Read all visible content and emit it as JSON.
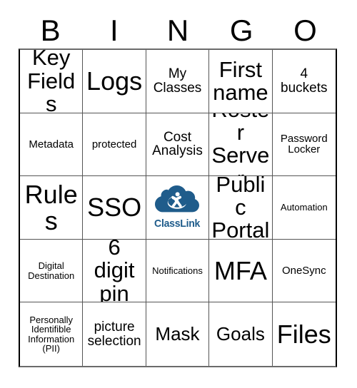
{
  "header": {
    "letters": [
      "B",
      "I",
      "N",
      "G",
      "O"
    ]
  },
  "grid": {
    "rows": 5,
    "columns": 5,
    "cells": [
      {
        "text": "Key\nFields",
        "size": "fs-xl",
        "type": "text"
      },
      {
        "text": "Logs",
        "size": "fs-xxl",
        "type": "text"
      },
      {
        "text": "My\nClasses",
        "size": "fs-md",
        "type": "text"
      },
      {
        "text": "First\nname",
        "size": "fs-xl",
        "type": "text"
      },
      {
        "text": "4\nbuckets",
        "size": "fs-md",
        "type": "text"
      },
      {
        "text": "Metadata",
        "size": "fs-sm",
        "type": "text"
      },
      {
        "text": "protected",
        "size": "fs-sm",
        "type": "text"
      },
      {
        "text": "Cost\nAnalysis",
        "size": "fs-md",
        "type": "text"
      },
      {
        "text": "Roster\nServer",
        "size": "fs-xl",
        "type": "text"
      },
      {
        "text": "Password\nLocker",
        "size": "fs-sm",
        "type": "text"
      },
      {
        "text": "Rules",
        "size": "fs-xxl",
        "type": "text"
      },
      {
        "text": "SSO",
        "size": "fs-xxl",
        "type": "text"
      },
      {
        "text": "ClassLink",
        "size": "fs-sm",
        "type": "logo"
      },
      {
        "text": "Public\nPortal",
        "size": "fs-xl",
        "type": "text"
      },
      {
        "text": "Automation",
        "size": "fs-xs",
        "type": "text"
      },
      {
        "text": "Digital\nDestination",
        "size": "fs-xs",
        "type": "text"
      },
      {
        "text": "6 digit\npin",
        "size": "fs-xl",
        "type": "text"
      },
      {
        "text": "Notifications",
        "size": "fs-xs",
        "type": "text"
      },
      {
        "text": "MFA",
        "size": "fs-xxl",
        "type": "text"
      },
      {
        "text": "OneSync",
        "size": "fs-sm",
        "type": "text"
      },
      {
        "text": "Personally\nIdentifible\nInformation\n(PII)",
        "size": "fs-xs",
        "type": "text"
      },
      {
        "text": "picture\nselection",
        "size": "fs-md",
        "type": "text"
      },
      {
        "text": "Mask",
        "size": "fs-lg",
        "type": "text"
      },
      {
        "text": "Goals",
        "size": "fs-lg",
        "type": "text"
      },
      {
        "text": "Files",
        "size": "fs-xxl",
        "type": "text"
      }
    ]
  },
  "logo": {
    "name": "classlink-logo",
    "wordmark": "ClassLink",
    "cloud_color": "#1F5C8B",
    "figure_color": "#FFFFFF",
    "wordmark_color": "#1F5C8B"
  },
  "colors": {
    "text": "#000000",
    "grid_line": "#555555",
    "outer_border": "#000000",
    "background": "#FFFFFF"
  }
}
